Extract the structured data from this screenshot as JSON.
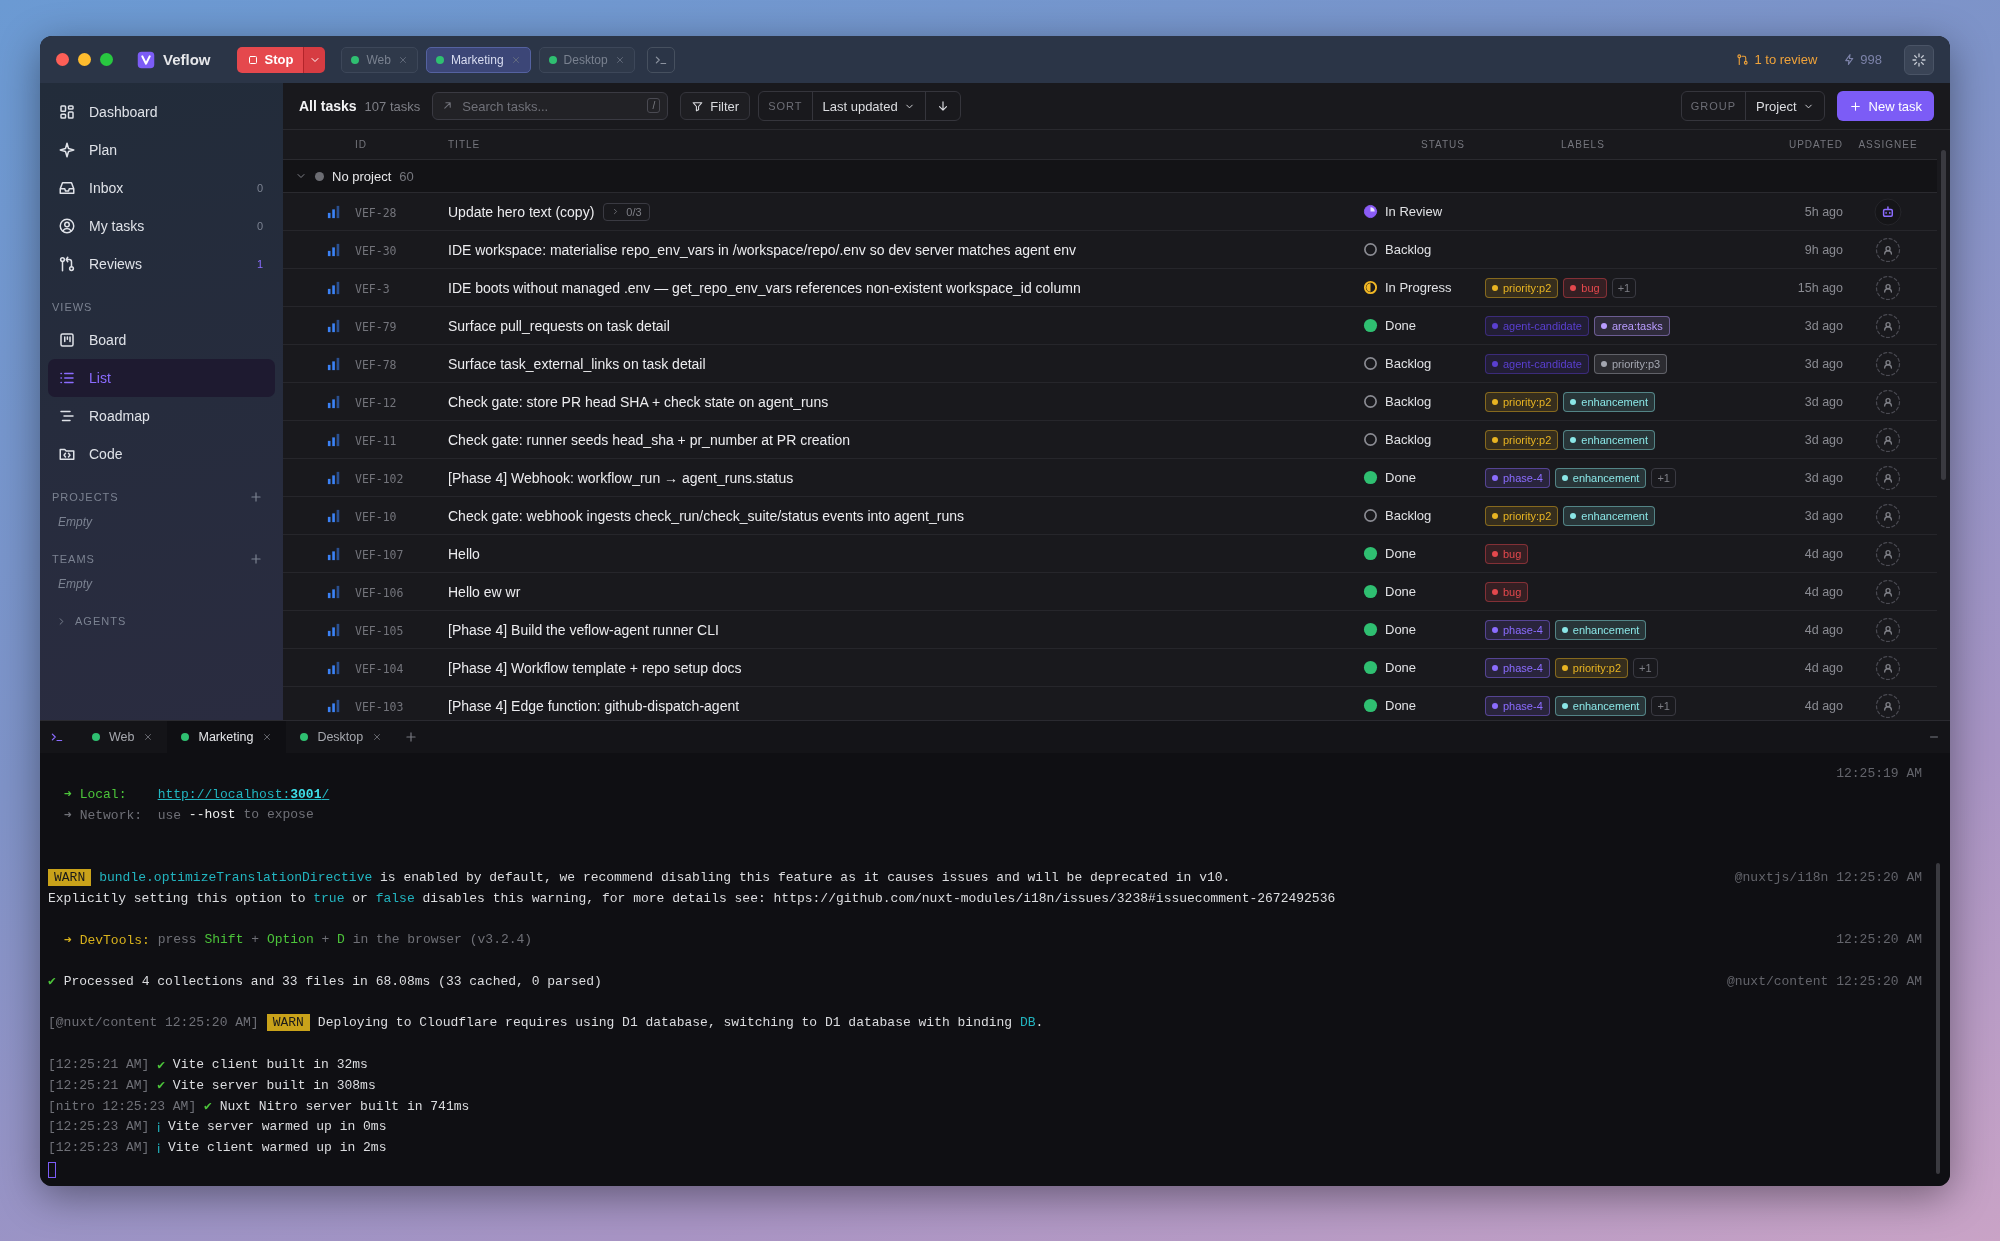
{
  "window": {
    "app_name": "Veflow",
    "stop_button": "Stop",
    "tabs": [
      {
        "label": "Web",
        "selected": false
      },
      {
        "label": "Marketing",
        "selected": true
      },
      {
        "label": "Desktop",
        "selected": false
      }
    ],
    "review_count": "1 to review",
    "credits": "998"
  },
  "sidebar": {
    "nav": [
      {
        "label": "Dashboard",
        "selected": false
      },
      {
        "label": "Plan",
        "selected": false
      },
      {
        "label": "Inbox",
        "count": "0",
        "highlighted": false,
        "selected": false
      },
      {
        "label": "My tasks",
        "count": "0",
        "highlighted": false,
        "selected": false
      },
      {
        "label": "Reviews",
        "count": "1",
        "highlighted": true,
        "selected": false
      }
    ],
    "views": {
      "heading": "VIEWS",
      "items": [
        {
          "label": "Board",
          "selected": false
        },
        {
          "label": "List",
          "selected": true
        },
        {
          "label": "Roadmap",
          "selected": false
        },
        {
          "label": "Code",
          "selected": false
        }
      ]
    },
    "projects": {
      "heading": "PROJECTS",
      "empty_text": "Empty"
    },
    "teams": {
      "heading": "TEAMS",
      "empty_text": "Empty"
    },
    "agents": {
      "heading": "AGENTS",
      "expanded": false
    }
  },
  "toolbar": {
    "title": "All tasks",
    "count": "107 tasks",
    "search": {
      "placeholder": "Search tasks...",
      "shortcut": "/"
    },
    "filter": "Filter",
    "sort_label": "SORT",
    "sort_value": "Last updated",
    "group_label": "GROUP",
    "group_value": "Project",
    "new_task": "New task"
  },
  "table": {
    "columns": [
      "ID",
      "TITLE",
      "STATUS",
      "LABELS",
      "UPDATED",
      "ASSIGNEE"
    ],
    "group": {
      "name": "No project",
      "count": "60",
      "expanded": true
    },
    "rows": [
      {
        "id": "VEF-28",
        "title": "Update hero text (copy)",
        "subtasks": "0/3",
        "status": {
          "kind": "review",
          "label": "In Review"
        },
        "updated": "5h ago",
        "assignee": {
          "kind": "agent"
        }
      },
      {
        "id": "VEF-30",
        "title": "IDE workspace: materialise repo_env_vars in /workspace/repo/.env so dev server matches agent env",
        "status": {
          "kind": "backlog",
          "label": "Backlog"
        },
        "updated": "9h ago",
        "assignee": {
          "kind": "unassigned"
        }
      },
      {
        "id": "VEF-3",
        "title": "IDE boots without managed .env — get_repo_env_vars references non-existent workspace_id column",
        "status": {
          "kind": "progress",
          "label": "In Progress"
        },
        "labels": {
          "tags": [
            {
              "text": "priority:p2",
              "color": "#e8b422"
            },
            {
              "text": "bug",
              "color": "#e5484d"
            }
          ],
          "more": "+1"
        },
        "updated": "15h ago",
        "assignee": {
          "kind": "unassigned"
        }
      },
      {
        "id": "VEF-79",
        "title": "Surface pull_requests on task detail",
        "status": {
          "kind": "done",
          "label": "Done"
        },
        "labels": {
          "tags": [
            {
              "text": "agent-candidate",
              "color": "#5a3fd0"
            },
            {
              "text": "area:tasks",
              "color": "#b99cff"
            }
          ]
        },
        "updated": "3d ago",
        "assignee": {
          "kind": "unassigned"
        }
      },
      {
        "id": "VEF-78",
        "title": "Surface task_external_links on task detail",
        "status": {
          "kind": "backlog",
          "label": "Backlog"
        },
        "labels": {
          "tags": [
            {
              "text": "agent-candidate",
              "color": "#5a3fd0"
            },
            {
              "text": "priority:p3",
              "color": "#a3a6b0"
            }
          ]
        },
        "updated": "3d ago",
        "assignee": {
          "kind": "unassigned"
        }
      },
      {
        "id": "VEF-12",
        "title": "Check gate: store PR head SHA + check state on agent_runs",
        "status": {
          "kind": "backlog",
          "label": "Backlog"
        },
        "labels": {
          "tags": [
            {
              "text": "priority:p2",
              "color": "#e8b422"
            },
            {
              "text": "enhancement",
              "color": "#8ae6e6"
            }
          ]
        },
        "updated": "3d ago",
        "assignee": {
          "kind": "unassigned"
        }
      },
      {
        "id": "VEF-11",
        "title": "Check gate: runner seeds head_sha + pr_number at PR creation",
        "status": {
          "kind": "backlog",
          "label": "Backlog"
        },
        "labels": {
          "tags": [
            {
              "text": "priority:p2",
              "color": "#e8b422"
            },
            {
              "text": "enhancement",
              "color": "#8ae6e6"
            }
          ]
        },
        "updated": "3d ago",
        "assignee": {
          "kind": "unassigned"
        }
      },
      {
        "id": "VEF-102",
        "title": "[Phase 4] Webhook: workflow_run → agent_runs.status",
        "status": {
          "kind": "done",
          "label": "Done"
        },
        "labels": {
          "tags": [
            {
              "text": "phase-4",
              "color": "#8b6cff"
            },
            {
              "text": "enhancement",
              "color": "#8ae6e6"
            }
          ],
          "more": "+1"
        },
        "updated": "3d ago",
        "assignee": {
          "kind": "unassigned"
        }
      },
      {
        "id": "VEF-10",
        "title": "Check gate: webhook ingests check_run/check_suite/status events into agent_runs",
        "status": {
          "kind": "backlog",
          "label": "Backlog"
        },
        "labels": {
          "tags": [
            {
              "text": "priority:p2",
              "color": "#e8b422"
            },
            {
              "text": "enhancement",
              "color": "#8ae6e6"
            }
          ]
        },
        "updated": "3d ago",
        "assignee": {
          "kind": "unassigned"
        }
      },
      {
        "id": "VEF-107",
        "title": "Hello",
        "status": {
          "kind": "done",
          "label": "Done"
        },
        "labels": {
          "tags": [
            {
              "text": "bug",
              "color": "#e5484d"
            }
          ]
        },
        "updated": "4d ago",
        "assignee": {
          "kind": "unassigned"
        }
      },
      {
        "id": "VEF-106",
        "title": "Hello ew wr",
        "status": {
          "kind": "done",
          "label": "Done"
        },
        "labels": {
          "tags": [
            {
              "text": "bug",
              "color": "#e5484d"
            }
          ]
        },
        "updated": "4d ago",
        "assignee": {
          "kind": "unassigned"
        }
      },
      {
        "id": "VEF-105",
        "title": "[Phase 4] Build the veflow-agent runner CLI",
        "status": {
          "kind": "done",
          "label": "Done"
        },
        "labels": {
          "tags": [
            {
              "text": "phase-4",
              "color": "#8b6cff"
            },
            {
              "text": "enhancement",
              "color": "#8ae6e6"
            }
          ]
        },
        "updated": "4d ago",
        "assignee": {
          "kind": "unassigned"
        }
      },
      {
        "id": "VEF-104",
        "title": "[Phase 4] Workflow template + repo setup docs",
        "status": {
          "kind": "done",
          "label": "Done"
        },
        "labels": {
          "tags": [
            {
              "text": "phase-4",
              "color": "#8b6cff"
            },
            {
              "text": "priority:p2",
              "color": "#e8b422"
            }
          ],
          "more": "+1"
        },
        "updated": "4d ago",
        "assignee": {
          "kind": "unassigned"
        }
      },
      {
        "id": "VEF-103",
        "title": "[Phase 4] Edge function: github-dispatch-agent",
        "status": {
          "kind": "done",
          "label": "Done"
        },
        "labels": {
          "tags": [
            {
              "text": "phase-4",
              "color": "#8b6cff"
            },
            {
              "text": "enhancement",
              "color": "#8ae6e6"
            }
          ],
          "more": "+1"
        },
        "updated": "4d ago",
        "assignee": {
          "kind": "unassigned"
        }
      }
    ]
  },
  "terminal": {
    "tabs": [
      {
        "label": "Web",
        "selected": false
      },
      {
        "label": "Marketing",
        "selected": true
      },
      {
        "label": "Desktop",
        "selected": false
      }
    ],
    "lines": [
      {
        "kind": "text",
        "meta": "12:25:19 AM"
      },
      {
        "kind": "text",
        "indented": true,
        "segments": [
          {
            "kind": "green",
            "text": "➜ Local:    "
          },
          {
            "kind": "link",
            "text": "http://localhost:**3001**/"
          }
        ]
      },
      {
        "kind": "text",
        "indented": true,
        "segments": [
          {
            "kind": "dim",
            "text": "➜ Network:  use "
          },
          {
            "kind": "bright",
            "text": "--host"
          },
          {
            "kind": "dim",
            "text": " to expose"
          }
        ]
      },
      {
        "kind": "blank"
      },
      {
        "kind": "blank"
      },
      {
        "kind": "text",
        "indented": false,
        "segments": [
          {
            "kind": "badge",
            "text": "WARN"
          },
          {
            "kind": "cyan",
            "text": "bundle.optimizeTranslationDirective"
          },
          {
            "kind": "plain",
            "text": " is enabled by default, we recommend disabling this feature as it causes issues and will be deprecated in v10."
          }
        ],
        "meta": "@nuxtjs/i18n 12:25:20 AM"
      },
      {
        "kind": "text",
        "indented": false,
        "segments": [
          {
            "kind": "plain",
            "text": "Explicitly setting this option to "
          },
          {
            "kind": "cyan",
            "text": "true"
          },
          {
            "kind": "plain",
            "text": " or "
          },
          {
            "kind": "cyan",
            "text": "false"
          },
          {
            "kind": "plain",
            "text": " disables this warning, for more details see: https://github.com/nuxt-modules/i18n/issues/3238#issuecomment-2672492536"
          }
        ]
      },
      {
        "kind": "blank"
      },
      {
        "kind": "text",
        "indented": true,
        "segments": [
          {
            "kind": "yellow",
            "text": "➜ DevTools:"
          },
          {
            "kind": "dim",
            "text": " press "
          },
          {
            "kind": "green",
            "text": "Shift"
          },
          {
            "kind": "dim",
            "text": " + "
          },
          {
            "kind": "green",
            "text": "Option"
          },
          {
            "kind": "dim",
            "text": " + "
          },
          {
            "kind": "green",
            "text": "D"
          },
          {
            "kind": "dim",
            "text": " in the browser (v3.2.4)"
          }
        ],
        "meta": "12:25:20 AM"
      },
      {
        "kind": "blank"
      },
      {
        "kind": "text",
        "indented": false,
        "segments": [
          {
            "kind": "green",
            "text": "✔"
          },
          {
            "kind": "plain",
            "text": " Processed 4 collections and 33 files in 68.08ms (33 cached, 0 parsed)"
          }
        ],
        "meta": "@nuxt/content 12:25:20 AM"
      },
      {
        "kind": "blank"
      },
      {
        "kind": "text",
        "indented": false,
        "segments": [
          {
            "kind": "dim",
            "text": "[@nuxt/content 12:25:20 AM]"
          },
          {
            "kind": "badge",
            "text": "WARN"
          },
          {
            "kind": "plain",
            "text": "Deploying to Cloudflare requires using D1 database, switching to D1 database with binding "
          },
          {
            "kind": "cyan",
            "text": "DB"
          },
          {
            "kind": "plain",
            "text": "."
          }
        ]
      },
      {
        "kind": "blank"
      },
      {
        "kind": "text",
        "indented": false,
        "segments": [
          {
            "kind": "dim",
            "text": "[12:25:21 AM] "
          },
          {
            "kind": "green",
            "text": "✔"
          },
          {
            "kind": "plain",
            "text": " Vite client built in 32ms"
          }
        ]
      },
      {
        "kind": "text",
        "indented": false,
        "segments": [
          {
            "kind": "dim",
            "text": "[12:25:21 AM] "
          },
          {
            "kind": "green",
            "text": "✔"
          },
          {
            "kind": "plain",
            "text": " Vite server built in 308ms"
          }
        ]
      },
      {
        "kind": "text",
        "indented": false,
        "segments": [
          {
            "kind": "dim",
            "text": "[nitro 12:25:23 AM] "
          },
          {
            "kind": "green",
            "text": "✔"
          },
          {
            "kind": "plain",
            "text": " Nuxt Nitro server built in 741ms"
          }
        ]
      },
      {
        "kind": "text",
        "indented": false,
        "segments": [
          {
            "kind": "dim",
            "text": "[12:25:23 AM] "
          },
          {
            "kind": "cyan",
            "text": "ℹ"
          },
          {
            "kind": "plain",
            "text": " Vite server warmed up in 0ms"
          }
        ]
      },
      {
        "kind": "text",
        "indented": false,
        "segments": [
          {
            "kind": "dim",
            "text": "[12:25:23 AM] "
          },
          {
            "kind": "cyan",
            "text": "ℹ"
          },
          {
            "kind": "plain",
            "text": " Vite client warmed up in 2ms"
          }
        ]
      }
    ]
  }
}
